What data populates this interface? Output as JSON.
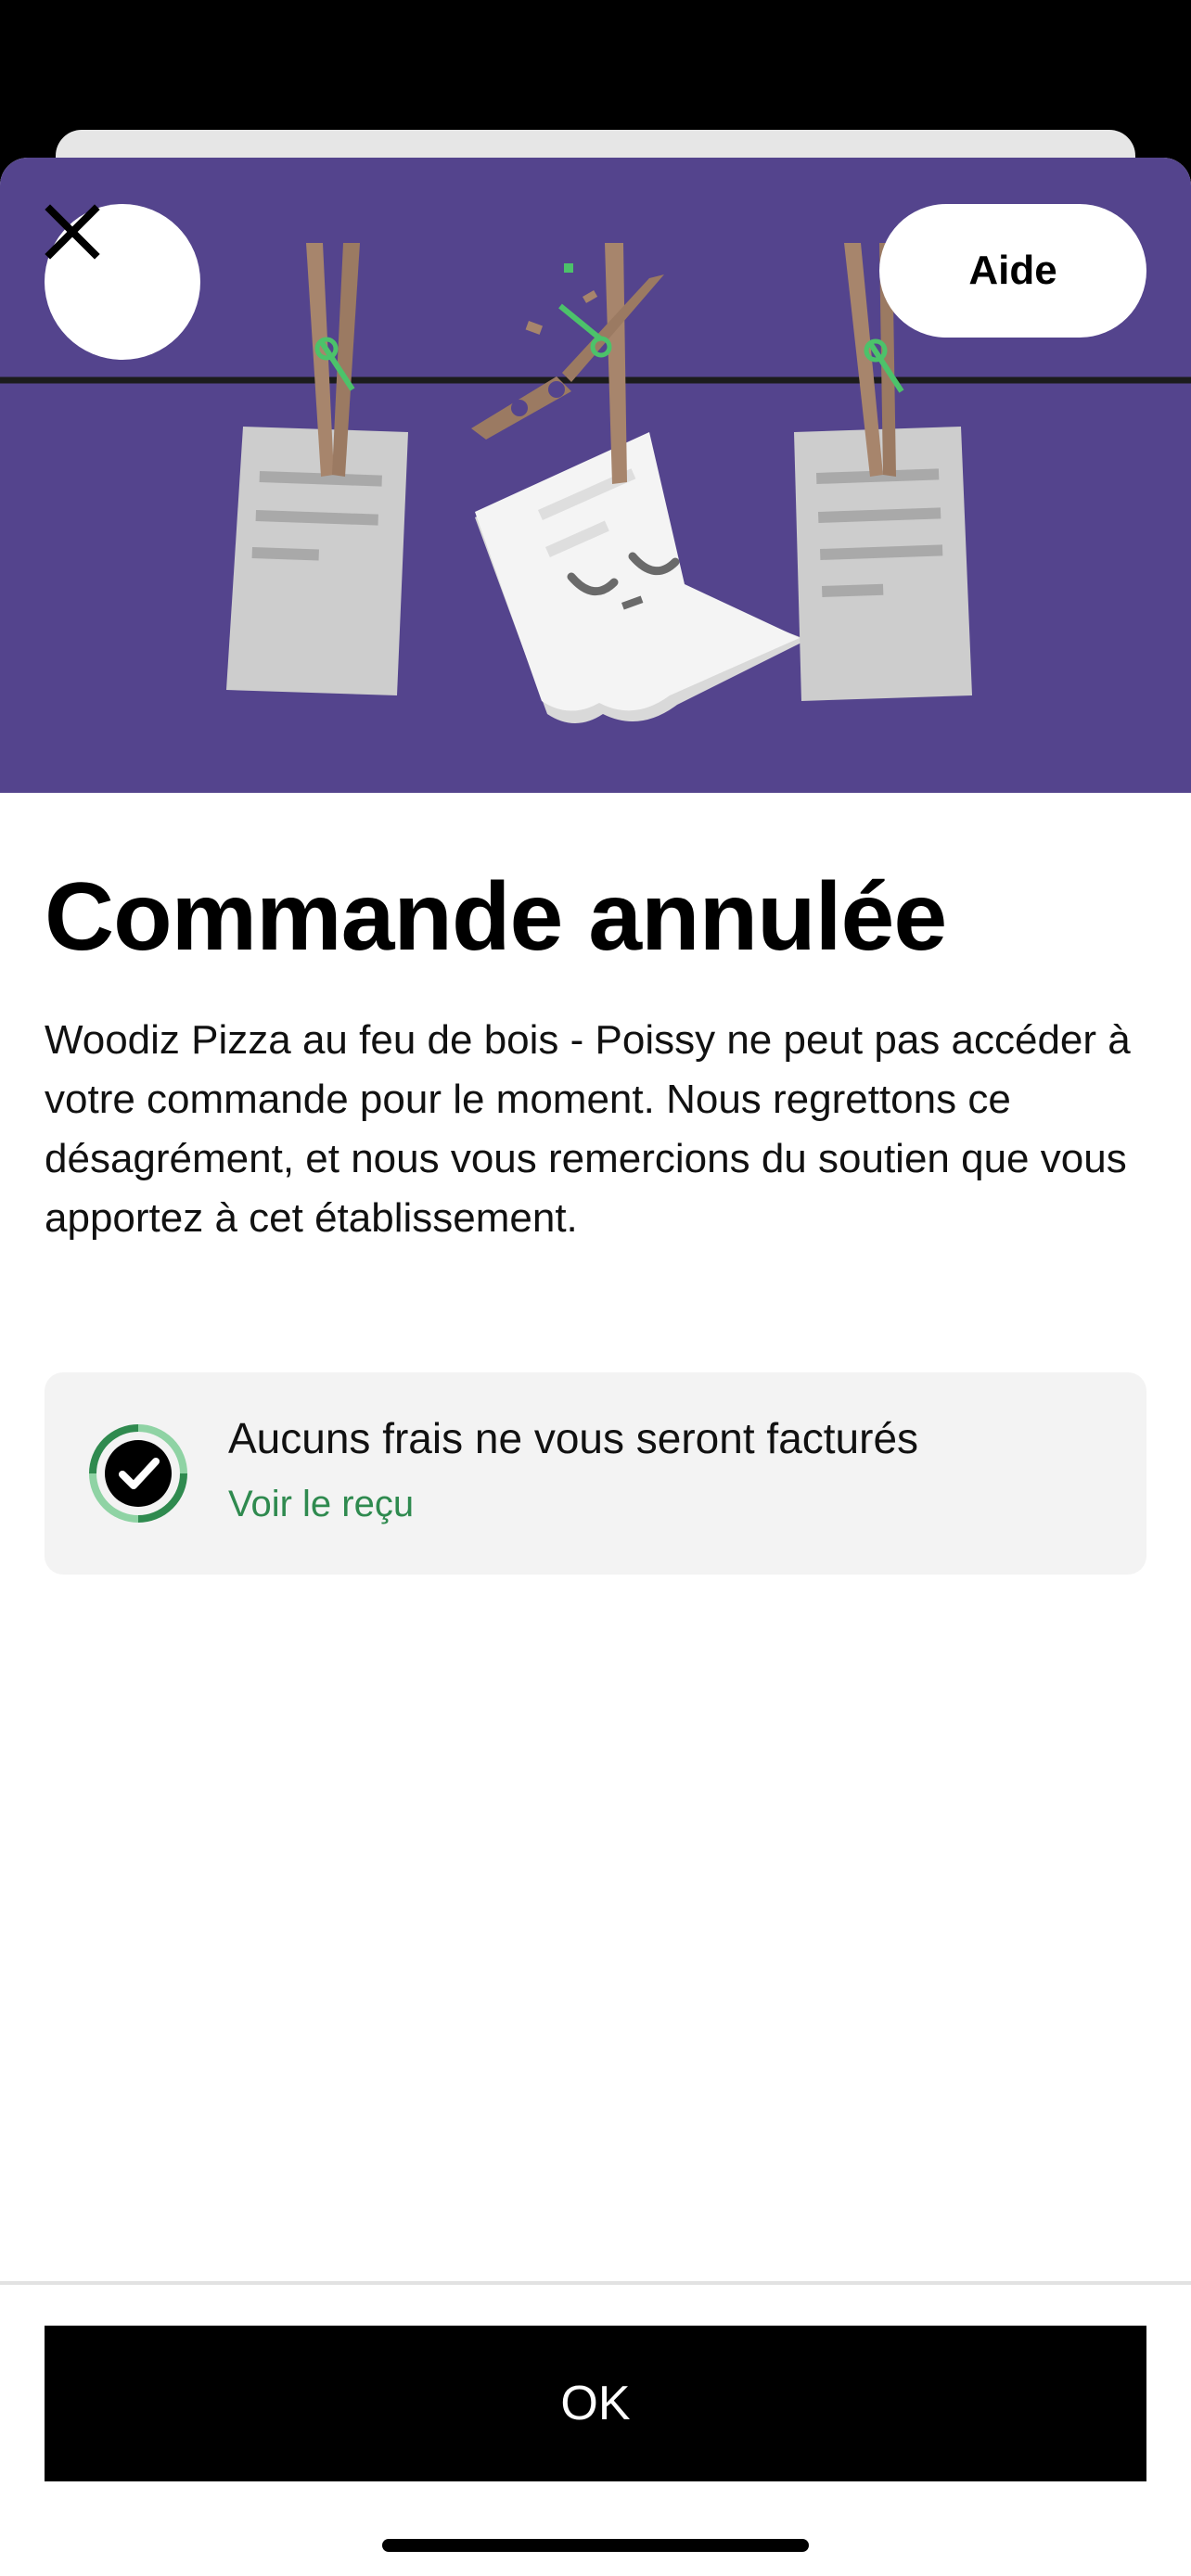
{
  "header": {
    "close_icon": "close-icon",
    "help_label": "Aide"
  },
  "hero": {
    "illustration": "clothesline-receipts-illustration",
    "colors": {
      "background": "#54448d",
      "accent": "#4cc26a"
    }
  },
  "main": {
    "title": "Commande annulée",
    "message": "Woodiz Pizza au feu de bois - Poissy ne peut pas accéder à votre commande pour le moment. Nous regrettons ce désagrément, et nous vous remercions du soutien que vous apportez à cet établissement."
  },
  "info_card": {
    "icon": "check-circle-icon",
    "text": "Aucuns frais ne vous seront facturés",
    "link_label": "Voir le reçu",
    "link_color": "#2f8a4f"
  },
  "footer": {
    "ok_label": "OK"
  }
}
